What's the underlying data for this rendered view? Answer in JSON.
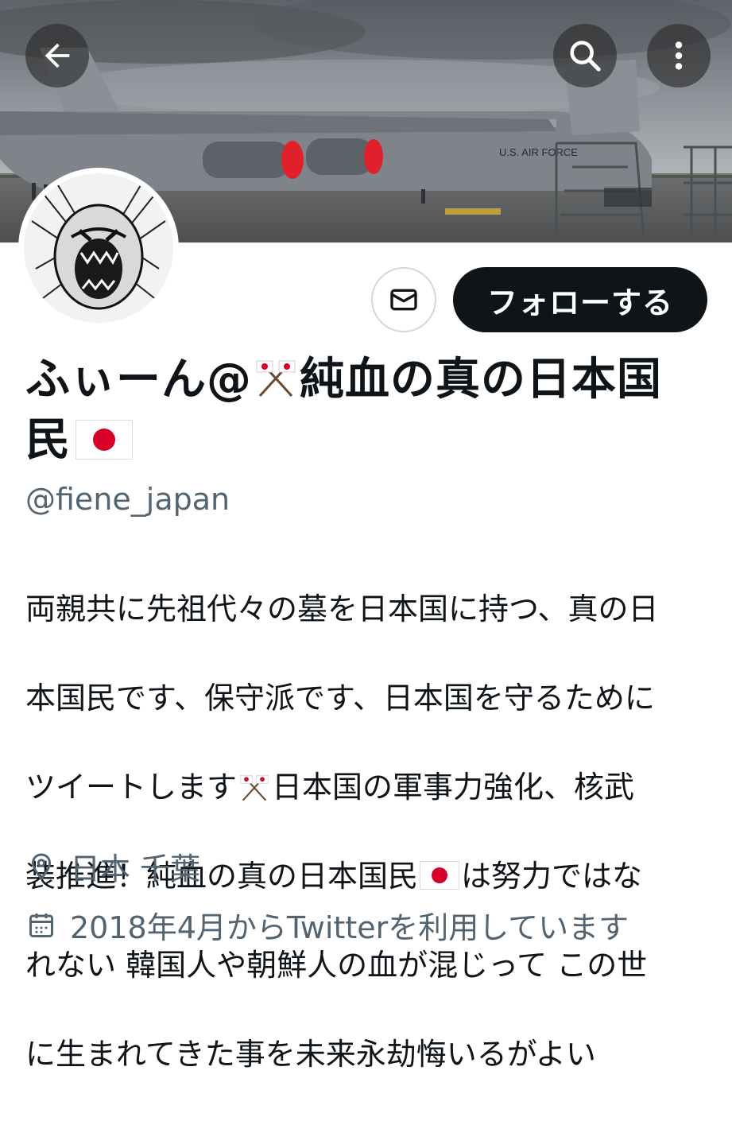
{
  "header": {
    "back_icon": "arrow-left-icon",
    "search_icon": "search-icon",
    "more_icon": "more-vertical-icon"
  },
  "profile": {
    "display_name_part1": "ふぃーん@",
    "display_name_part2": "純血の真の日本国",
    "display_name_part3": "民",
    "handle": "@fiene_japan",
    "follow_label": "フォローする",
    "message_icon": "mail-icon",
    "bio_lines": [
      "両親共に先祖代々の墓を日本国に持つ、真の日",
      "本国民です、保守派です、日本国を守るために",
      "ツイートします",
      "日本国の軍事力強化、核武",
      "装推進！純血の真の日本国民",
      "は努力ではな",
      "れない 韓国人や朝鮮人の血が混じって この世",
      "に生まれてきた事を未来永劫悔いるがよい"
    ],
    "location": "日本 千葉",
    "joined": "2018年4月からTwitterを利用しています",
    "location_icon": "location-pin-icon",
    "calendar_icon": "calendar-icon"
  },
  "colors": {
    "follow_bg": "#0f1419",
    "secondary_text": "#536471",
    "flag_red": "#d7002a"
  }
}
